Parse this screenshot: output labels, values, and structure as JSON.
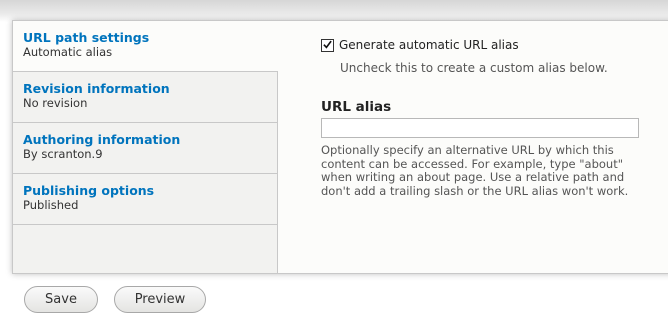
{
  "vertical_tabs": [
    {
      "title": "URL path settings",
      "summary": "Automatic alias",
      "selected": true
    },
    {
      "title": "Revision information",
      "summary": "No revision",
      "selected": false
    },
    {
      "title": "Authoring information",
      "summary": "By scranton.9",
      "selected": false
    },
    {
      "title": "Publishing options",
      "summary": "Published",
      "selected": false
    }
  ],
  "url_path": {
    "checkbox_label": "Generate automatic URL alias",
    "checkbox_checked": true,
    "checkbox_description": "Uncheck this to create a custom alias below.",
    "alias_label": "URL alias",
    "alias_value": "",
    "alias_description": "Optionally specify an alternative URL by which this content can be accessed. For example, type \"about\" when writing an about page. Use a relative path and don't add a trailing slash or the URL alias won't work."
  },
  "actions": {
    "save_label": "Save",
    "preview_label": "Preview"
  },
  "colors": {
    "link": "#0074bd",
    "tab_background": "#f2f2f0",
    "panel_background": "#fcfcfa"
  }
}
